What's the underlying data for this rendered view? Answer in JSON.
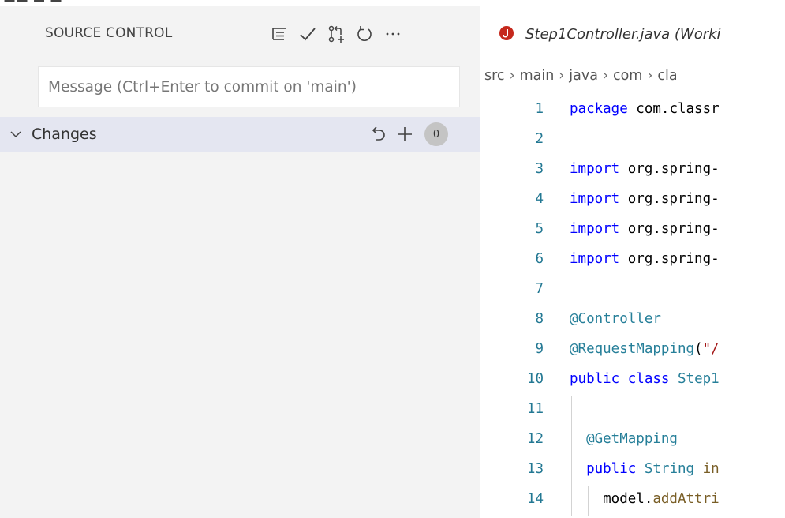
{
  "sidebar": {
    "title": "SOURCE CONTROL",
    "actions": [
      {
        "icon": "view-as-tree-icon"
      },
      {
        "icon": "commit-check-icon"
      },
      {
        "icon": "pull-request-icon"
      },
      {
        "icon": "refresh-icon"
      },
      {
        "icon": "more-actions-icon"
      }
    ],
    "commit_placeholder": "Message (Ctrl+Enter to commit on 'main')",
    "commit_value": "",
    "changes": {
      "label": "Changes",
      "count": "0",
      "actions": [
        {
          "icon": "discard-changes-icon"
        },
        {
          "icon": "stage-all-icon"
        }
      ]
    }
  },
  "editor": {
    "tab": {
      "icon": "java-error-icon",
      "title": "Step1Controller.java (Worki"
    },
    "breadcrumb": [
      "src",
      "main",
      "java",
      "com",
      "cla"
    ],
    "lines": [
      {
        "n": "1",
        "parts": [
          [
            "kw",
            "package"
          ],
          [
            "pl",
            " com.classr"
          ]
        ]
      },
      {
        "n": "2",
        "parts": []
      },
      {
        "n": "3",
        "parts": [
          [
            "kw",
            "import"
          ],
          [
            "pl",
            " org.spring-"
          ]
        ]
      },
      {
        "n": "4",
        "parts": [
          [
            "kw",
            "import"
          ],
          [
            "pl",
            " org.spring-"
          ]
        ]
      },
      {
        "n": "5",
        "parts": [
          [
            "kw",
            "import"
          ],
          [
            "pl",
            " org.spring-"
          ]
        ]
      },
      {
        "n": "6",
        "parts": [
          [
            "kw",
            "import"
          ],
          [
            "pl",
            " org.spring-"
          ]
        ]
      },
      {
        "n": "7",
        "parts": []
      },
      {
        "n": "8",
        "parts": [
          [
            "ann",
            "@Controller"
          ]
        ]
      },
      {
        "n": "9",
        "parts": [
          [
            "ann",
            "@RequestMapping"
          ],
          [
            "pl",
            "("
          ],
          [
            "str",
            "\"/"
          ]
        ]
      },
      {
        "n": "10",
        "parts": [
          [
            "kw",
            "public"
          ],
          [
            "pl",
            " "
          ],
          [
            "kw",
            "class"
          ],
          [
            "pl",
            " "
          ],
          [
            "ty",
            "Step1"
          ]
        ]
      },
      {
        "n": "11",
        "parts": []
      },
      {
        "n": "12",
        "parts": [
          [
            "ann",
            "  @GetMapping"
          ]
        ]
      },
      {
        "n": "13",
        "parts": [
          [
            "kw",
            "  public"
          ],
          [
            "pl",
            " "
          ],
          [
            "ty",
            "String"
          ],
          [
            "pl",
            " "
          ],
          [
            "fn",
            "in"
          ]
        ]
      },
      {
        "n": "14",
        "parts": [
          [
            "pl",
            "    model."
          ],
          [
            "fn",
            "addAttri"
          ]
        ]
      }
    ]
  },
  "colors": {
    "sidebar_bg": "#f3f3f3",
    "changes_row_bg": "#e4e6f1",
    "badge_bg": "#c4c4c4",
    "line_number": "#237893",
    "keyword": "#0000ff",
    "annotation": "#267f99",
    "error_icon": "#e51400"
  }
}
